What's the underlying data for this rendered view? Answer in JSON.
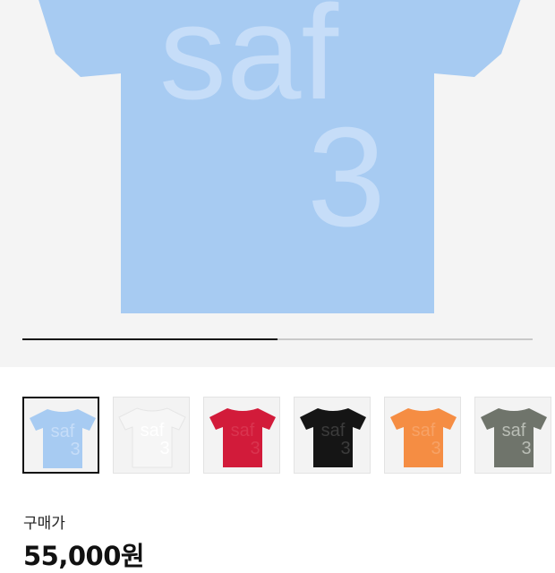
{
  "product": {
    "print_word": "saf",
    "print_number": "3",
    "color_hex": "#a7cbf2",
    "print_hex": "#c6ddf8"
  },
  "gallery": {
    "progress": 0.5
  },
  "swatches": [
    {
      "name": "light-blue",
      "shirt": "#a7cbf2",
      "print": "#c6ddf8",
      "text": "saf",
      "num": "3"
    },
    {
      "name": "white",
      "shirt": "#f6f6f6",
      "print": "#ffffff",
      "text": "saf",
      "num": "3"
    },
    {
      "name": "red",
      "shirt": "#d21b3a",
      "print": "#d9344f",
      "text": "saf",
      "num": "3"
    },
    {
      "name": "black",
      "shirt": "#151515",
      "print": "#3b3b3b",
      "text": "saf",
      "num": "3"
    },
    {
      "name": "orange",
      "shirt": "#f58d43",
      "print": "#f7a266",
      "text": "saf",
      "num": "3"
    },
    {
      "name": "gray",
      "shirt": "#6f746b",
      "print": "#b9bdb5",
      "text": "saf",
      "num": "3"
    }
  ],
  "purchase": {
    "label": "구매가",
    "price": "55,000원"
  }
}
